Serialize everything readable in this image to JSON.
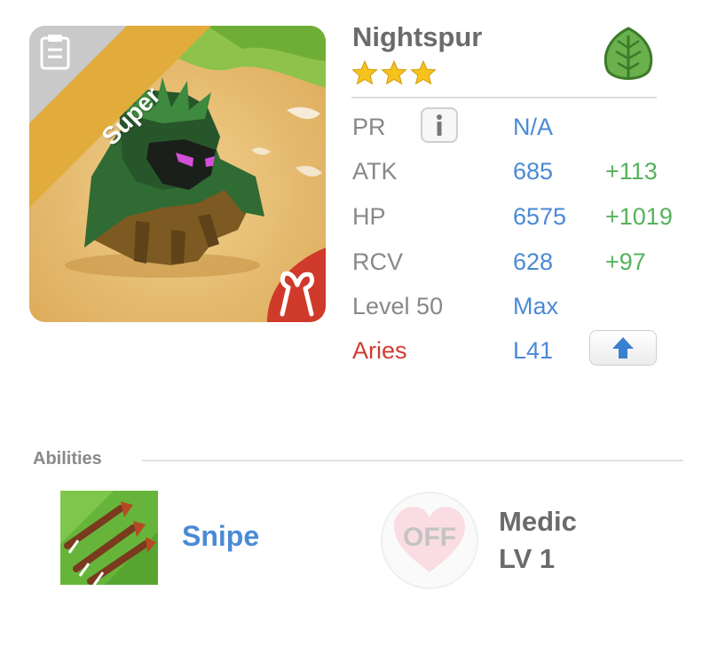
{
  "pet": {
    "name": "Nightspur",
    "rarity_stars": 3,
    "rank_ribbon": "Super",
    "element_icon": "leaf-icon",
    "zodiac_icon": "aries-icon"
  },
  "stats": {
    "pr_label": "PR",
    "pr_value": "N/A",
    "atk_label": "ATK",
    "atk_value": "685",
    "atk_bonus": "+113",
    "hp_label": "HP",
    "hp_value": "6575",
    "hp_bonus": "+1019",
    "rcv_label": "RCV",
    "rcv_value": "628",
    "rcv_bonus": "+97",
    "level_label": "Level 50",
    "level_value": "Max",
    "zodiac_label": "Aries",
    "zodiac_level": "L41"
  },
  "abilities": {
    "section_title": "Abilities",
    "ability1_name": "Snipe",
    "ability2_status": "OFF",
    "ability2_name": "Medic",
    "ability2_level": "LV 1"
  },
  "colors": {
    "stat_value": "#4a8ad6",
    "stat_bonus": "#55b25c",
    "zodiac": "#d23b32",
    "star": "#f6c21c"
  }
}
